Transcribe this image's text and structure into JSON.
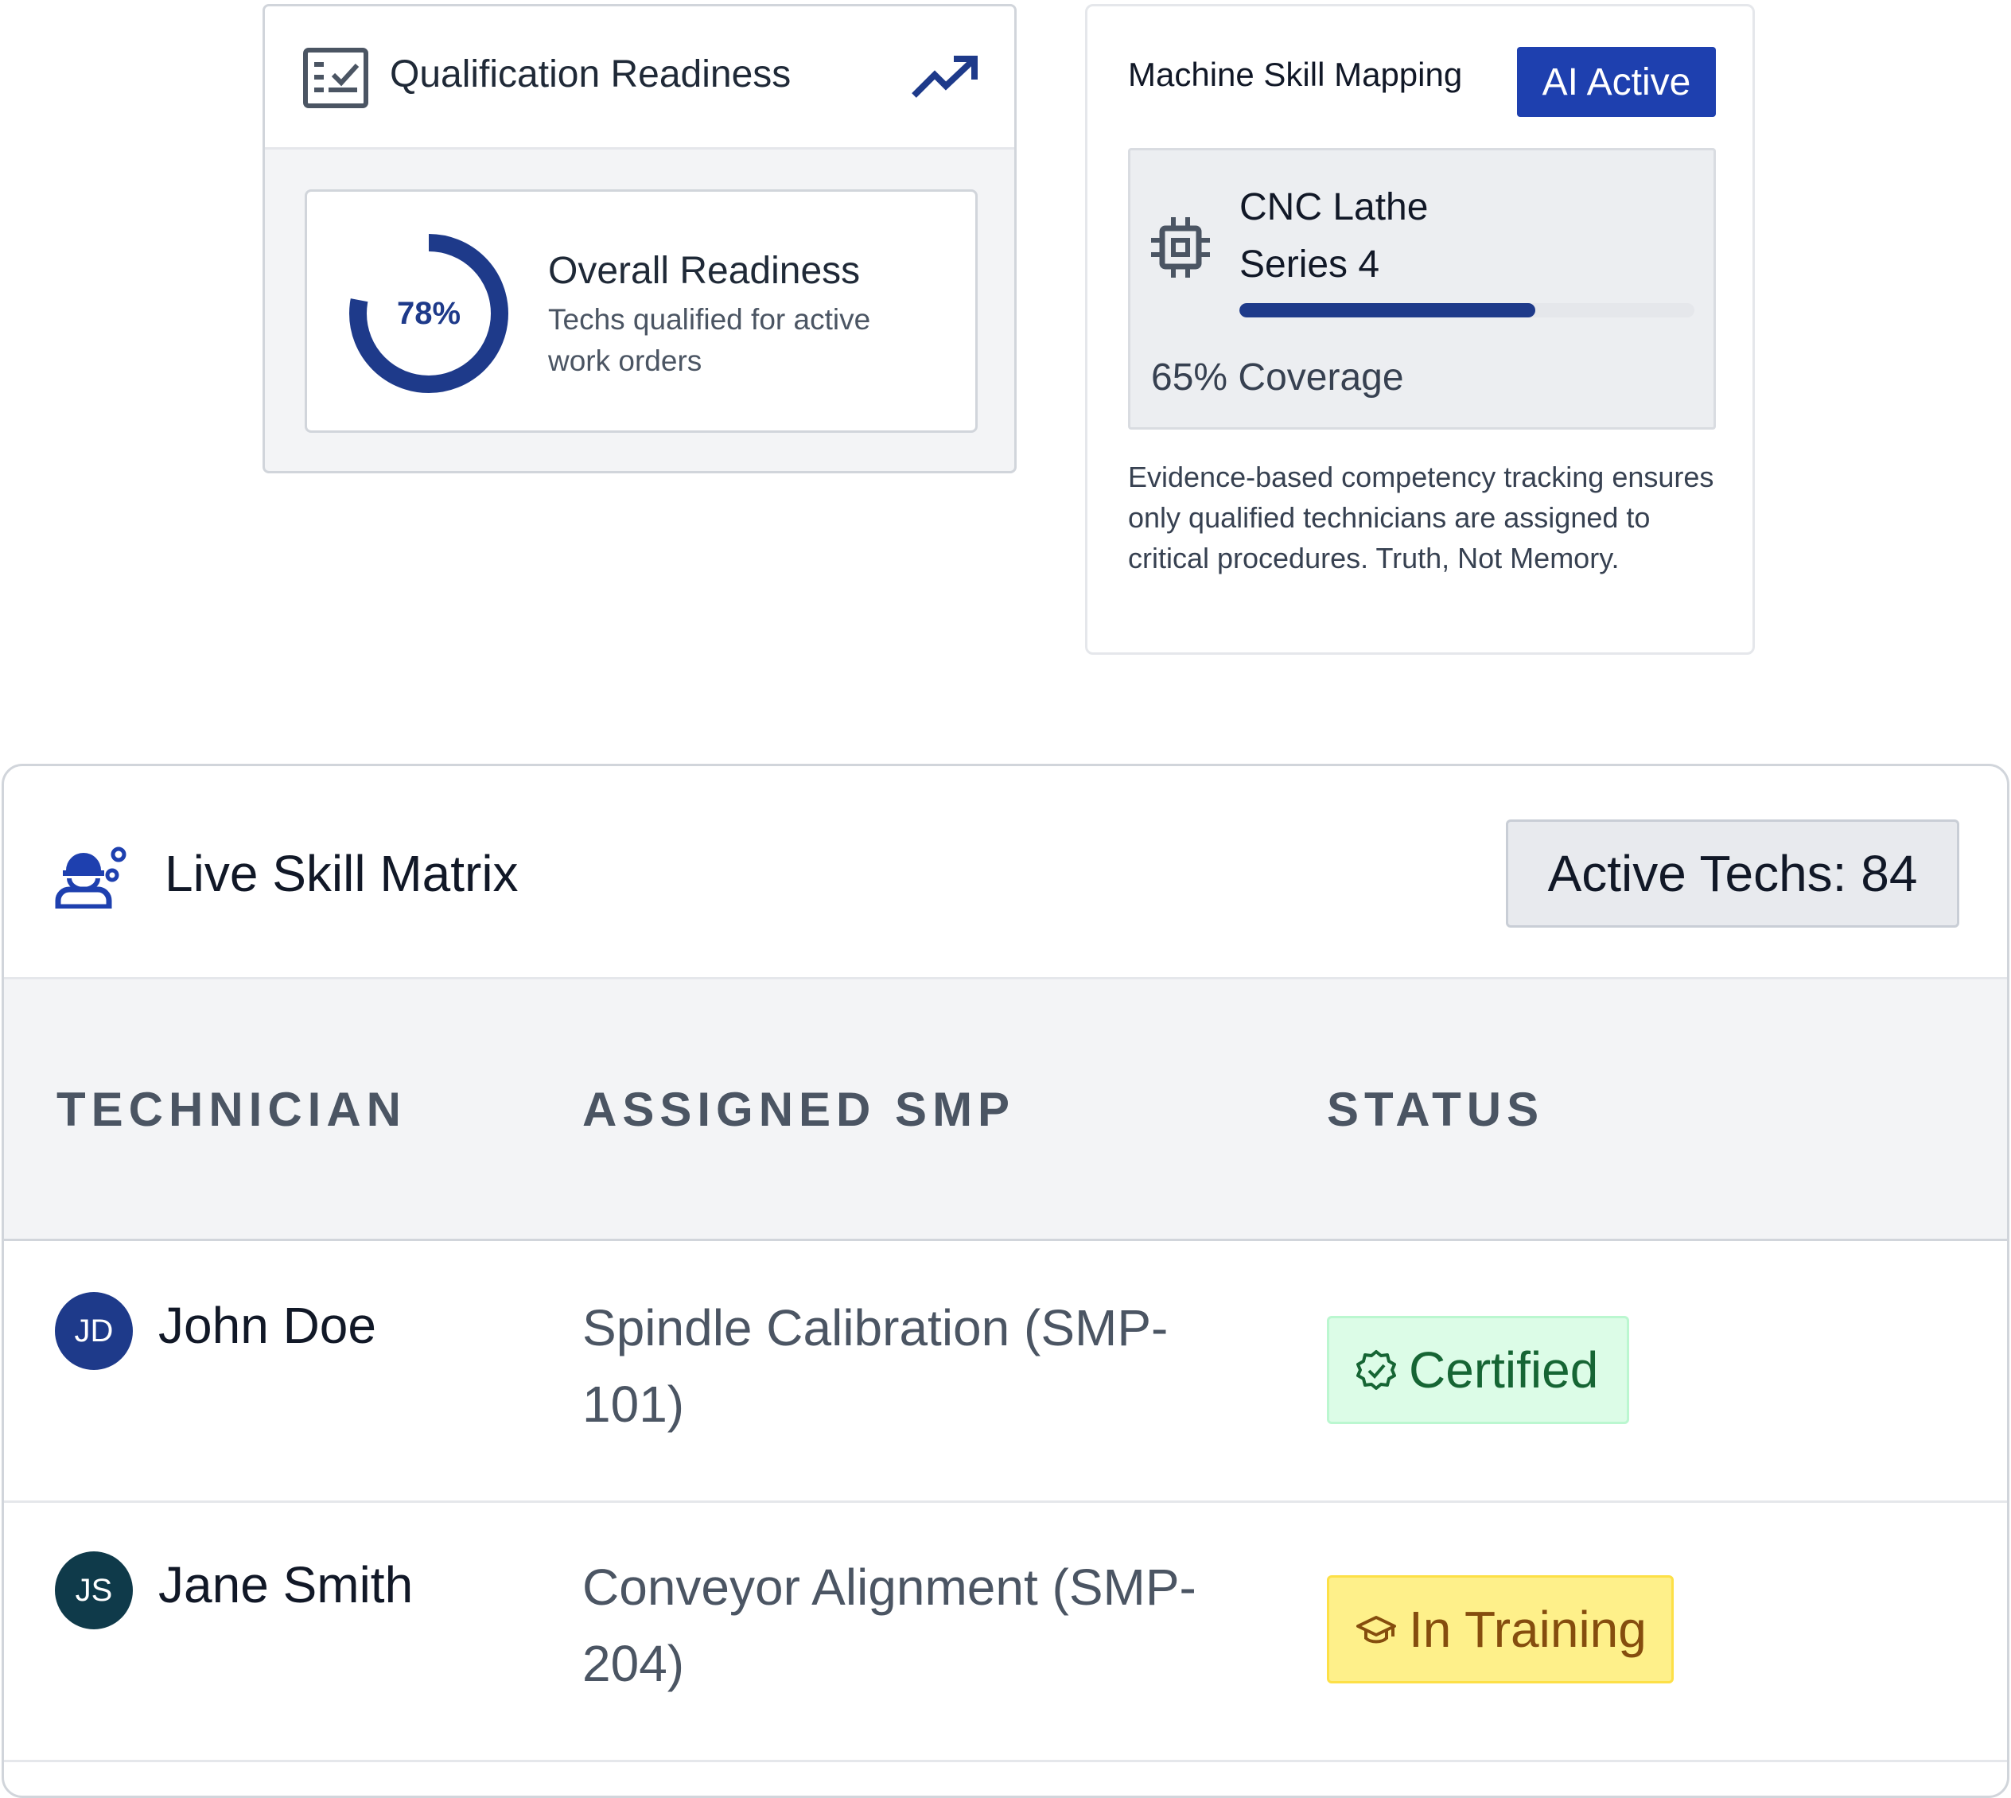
{
  "qualification": {
    "title": "Qualification Readiness",
    "icons": [
      "checklist-icon",
      "trending-up-icon"
    ],
    "readiness_percent": 78,
    "readiness_label": "78%",
    "metric_title": "Overall Readiness",
    "metric_description": "Techs qualified for active work orders"
  },
  "machine_mapping": {
    "title": "Machine Skill Mapping",
    "badge": "AI Active",
    "machine_name": "CNC Lathe Series 4",
    "machine_icon": "chip-icon",
    "coverage_percent": 65,
    "coverage_label": "65% Coverage",
    "description": "Evidence-based competency tracking ensures only qualified technicians are assigned to critical procedures. Truth, Not Memory."
  },
  "skill_matrix": {
    "title": "Live Skill Matrix",
    "icon": "engineer-gears-icon",
    "active_techs": "Active Techs: 84",
    "columns": [
      "TECHNICIAN",
      "ASSIGNED SMP",
      "STATUS"
    ],
    "rows": [
      {
        "initials": "JD",
        "name": "John Doe",
        "smp": "Spindle Calibration (SMP-101)",
        "status": "Certified",
        "status_icon": "verified-badge-icon",
        "avatar_color": "#1e3a8a"
      },
      {
        "initials": "JS",
        "name": "Jane Smith",
        "smp": "Conveyor Alignment (SMP-204)",
        "status": "In Training",
        "status_icon": "graduation-cap-icon",
        "avatar_color": "#0f3a4a"
      }
    ]
  },
  "colors": {
    "accent": "#1e3a8a",
    "badge_blue": "#1e40af",
    "certified_bg": "#dcfce7",
    "certified_text": "#166534",
    "training_bg": "#fef08a",
    "training_text": "#854d0e"
  }
}
